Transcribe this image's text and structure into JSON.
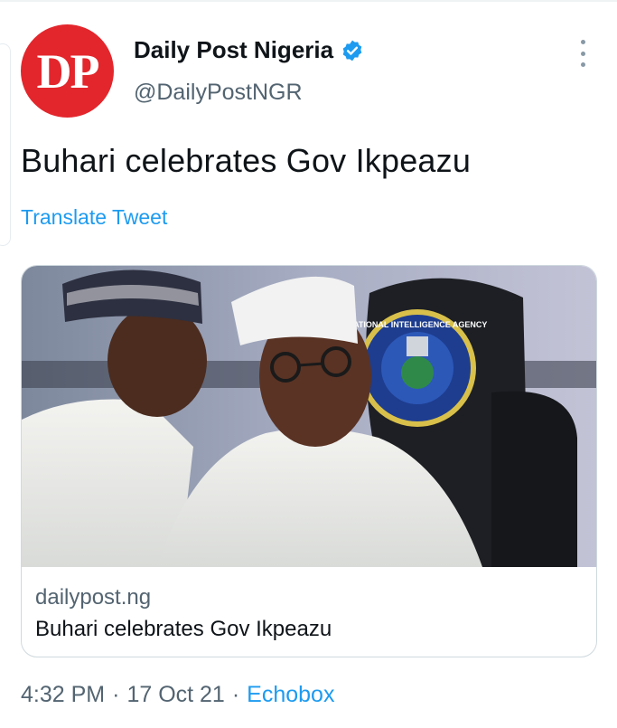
{
  "account": {
    "avatar_text": "DP",
    "display_name": "Daily Post Nigeria",
    "handle": "@DailyPostNGR",
    "verified": true
  },
  "tweet": {
    "text": "Buhari celebrates Gov Ikpeazu",
    "translate_label": "Translate Tweet"
  },
  "link_card": {
    "image_description_icon": "photo-two-men-seated-agency-chair",
    "chair_emblem_text": "NATIONAL INTELLIGENCE AGENCY",
    "domain": "dailypost.ng",
    "title": "Buhari celebrates Gov Ikpeazu"
  },
  "meta": {
    "time": "4:32 PM",
    "separator": "·",
    "date": "17 Oct 21",
    "source": "Echobox"
  },
  "colors": {
    "brand_red": "#e3262c",
    "link_blue": "#1d9bf0",
    "secondary_text": "#536471"
  }
}
